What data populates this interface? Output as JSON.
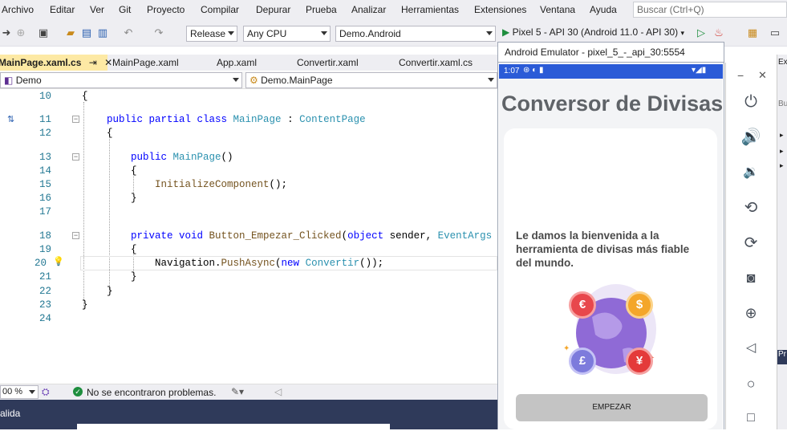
{
  "menu": {
    "items": [
      "Archivo",
      "Editar",
      "Ver",
      "Git",
      "Proyecto",
      "Compilar",
      "Depurar",
      "Prueba",
      "Analizar",
      "Herramientas",
      "Extensiones",
      "Ventana",
      "Ayuda"
    ],
    "search_placeholder": "Buscar (Ctrl+Q)"
  },
  "toolbar": {
    "configuration": "Release",
    "platform": "Any CPU",
    "startup_project": "Demo.Android",
    "run_target": "Pixel 5 - API 30 (Android 11.0 - API 30)"
  },
  "tabs": [
    "MainPage.xaml.cs",
    "MainPage.xaml",
    "App.xaml",
    "Convertir.xaml",
    "Convertir.xaml.cs"
  ],
  "tab_pin": "⇥",
  "tab_close": "✕",
  "nav": {
    "project": "Demo",
    "class": "Demo.MainPage"
  },
  "code_lines": [
    {
      "n": "10",
      "text": "{"
    },
    {
      "n": "11",
      "text": "public partial class MainPage : ContentPage"
    },
    {
      "n": "12",
      "text": "{"
    },
    {
      "n": "13",
      "text": "public MainPage()"
    },
    {
      "n": "14",
      "text": "{"
    },
    {
      "n": "15",
      "text": "InitializeComponent();"
    },
    {
      "n": "16",
      "text": "}"
    },
    {
      "n": "17",
      "text": ""
    },
    {
      "n": "18",
      "text": "private void Button_Empezar_Clicked(object sender, EventArgs"
    },
    {
      "n": "19",
      "text": "{"
    },
    {
      "n": "20",
      "text": "Navigation.PushAsync(new Convertir());"
    },
    {
      "n": "21",
      "text": "}"
    },
    {
      "n": "22",
      "text": "}"
    },
    {
      "n": "23",
      "text": "}"
    },
    {
      "n": "24",
      "text": ""
    }
  ],
  "status": {
    "zoom": "00 %",
    "issues": "No se encontraron problemas."
  },
  "output": {
    "title": "alida"
  },
  "emulator": {
    "title": "Android Emulator - pixel_5_-_api_30:5554",
    "time": "1:07",
    "app_title": "Conversor de Divisas",
    "welcome": "Le damos la bienvenida a la herramienta de divisas más fiable del mundo.",
    "button": "EMPEZAR",
    "coins": [
      "€",
      "$",
      "£",
      "¥"
    ]
  },
  "right_panel": {
    "tab_ex": "Ex",
    "tab_bu": "Bu",
    "tab_pr": "Pr"
  },
  "colors": {
    "accent_blue": "#2b5bd7",
    "active_tab": "#fde9a4",
    "run_green": "#1e8e3e",
    "button_gray": "#c4c4c4"
  }
}
